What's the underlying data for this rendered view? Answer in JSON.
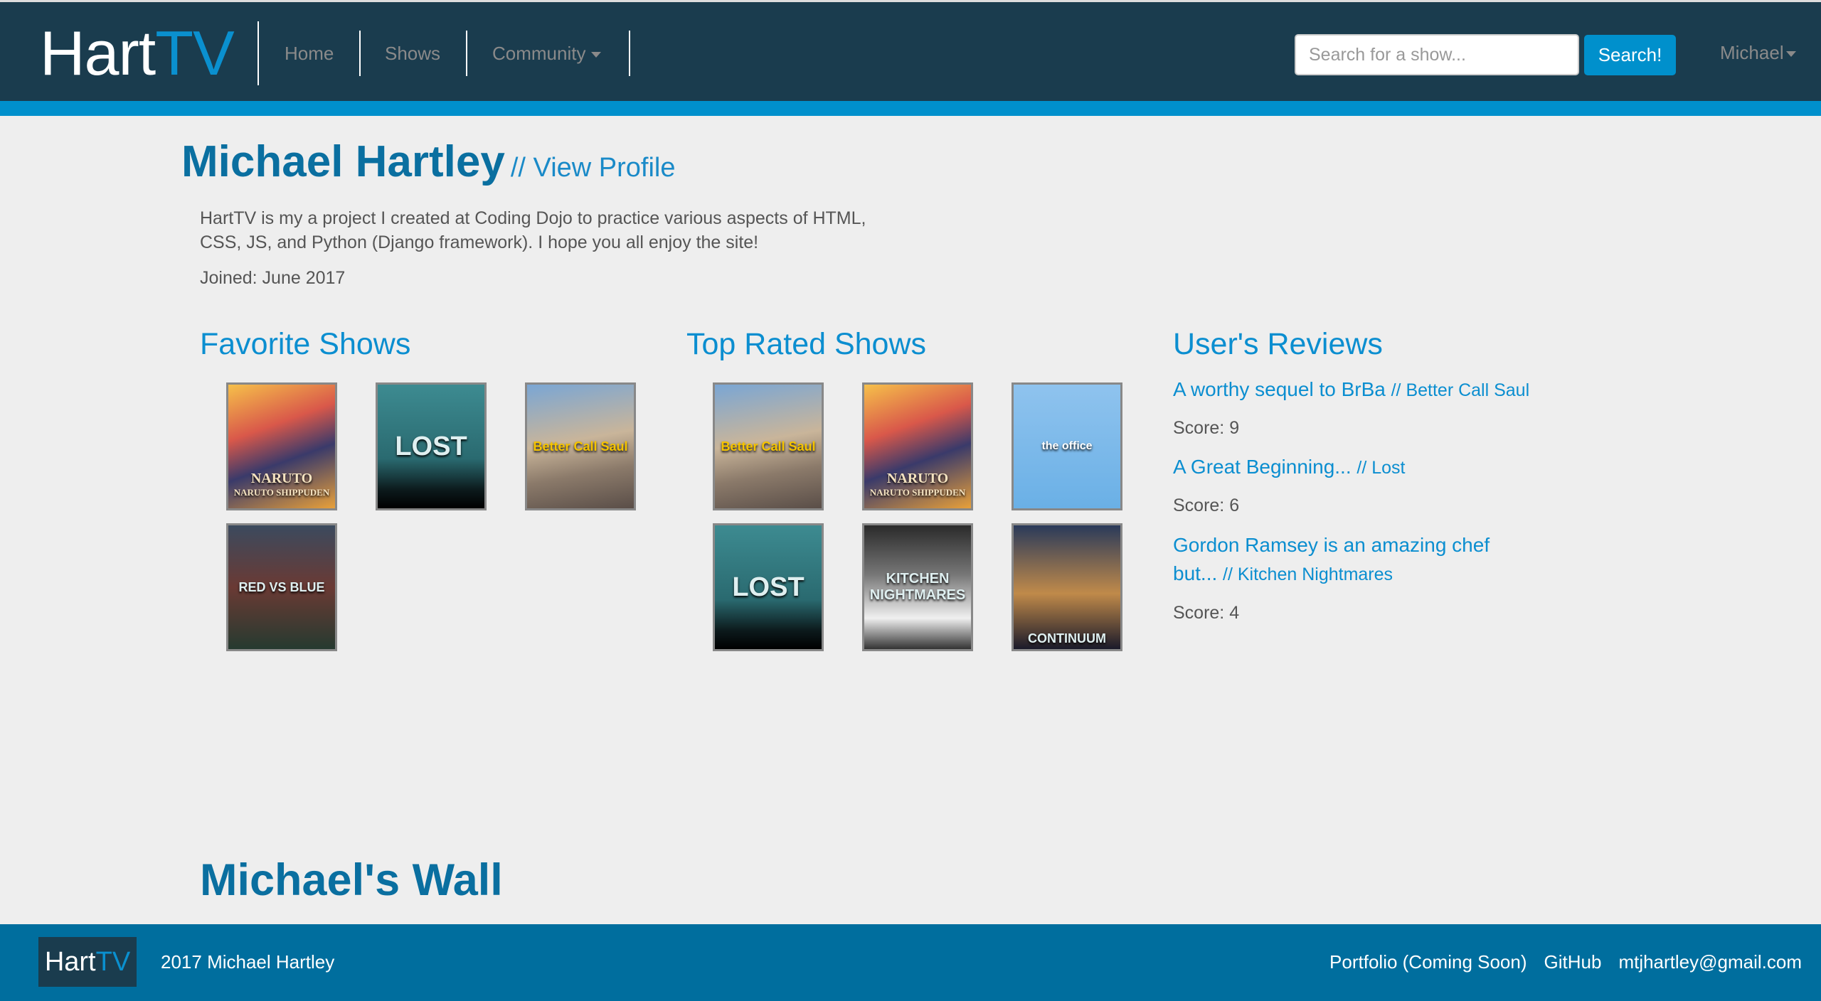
{
  "nav": {
    "logo_main": "Hart",
    "logo_accent": "TV",
    "links": [
      "Home",
      "Shows",
      "Community"
    ],
    "search_placeholder": "Search for a show...",
    "search_button": "Search!",
    "user": "Michael"
  },
  "profile": {
    "name": "Michael Hartley",
    "view_profile": "// View Profile",
    "bio_line1": "HartTV is my a project I created at Coding Dojo to practice various aspects of HTML,",
    "bio_line2": "CSS, JS, and Python (Django framework). I hope you all enjoy the site!",
    "joined": "Joined: June 2017"
  },
  "favorites": {
    "title": "Favorite Shows",
    "posters": [
      {
        "show": "Naruto Shippuden",
        "art": "NARUTO"
      },
      {
        "show": "Lost",
        "art": "LOST"
      },
      {
        "show": "Better Call Saul",
        "art": "Better Call Saul"
      },
      {
        "show": "Red vs Blue",
        "art": "RED VS BLUE"
      }
    ]
  },
  "top_rated": {
    "title": "Top Rated Shows",
    "posters": [
      {
        "show": "Better Call Saul",
        "art": "Better Call Saul"
      },
      {
        "show": "Naruto Shippuden",
        "art": "NARUTO"
      },
      {
        "show": "The Office",
        "art": "the office"
      },
      {
        "show": "Lost",
        "art": "LOST"
      },
      {
        "show": "Kitchen Nightmares",
        "art": "KITCHEN NIGHTMARES"
      },
      {
        "show": "Continuum",
        "art": "CONTINUUM"
      }
    ]
  },
  "reviews": {
    "title": "User's Reviews",
    "items": [
      {
        "title": "A worthy sequel to BrBa",
        "show": "// Better Call Saul",
        "score": "Score: 9"
      },
      {
        "title": "A Great Beginning...",
        "show": "// Lost",
        "score": "Score: 6"
      },
      {
        "title": "Gordon Ramsey is an amazing chef but...",
        "show": "// Kitchen Nightmares",
        "score": "Score: 4"
      }
    ]
  },
  "wall": {
    "title": "Michael's Wall"
  },
  "footer": {
    "logo_main": "Hart",
    "logo_accent": "TV",
    "copyright": "2017 Michael Hartley",
    "links": [
      "Portfolio (Coming Soon)",
      "GitHub",
      "mtjhartley@gmail.com"
    ]
  },
  "colors": {
    "navbar": "#1a3c4e",
    "accent": "#0090cc",
    "heading": "#0a6fa0",
    "footer": "#006e9e",
    "background": "#eeeeee"
  }
}
